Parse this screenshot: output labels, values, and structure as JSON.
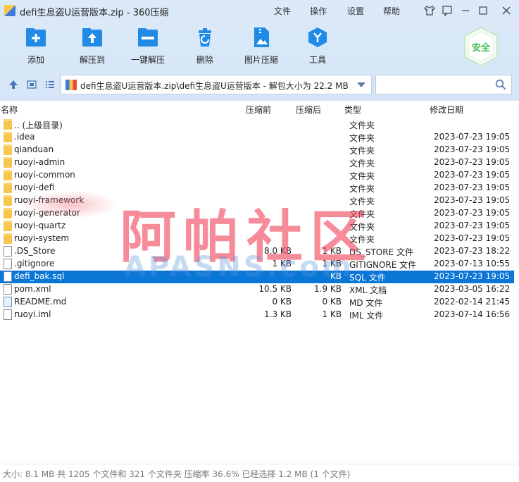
{
  "window": {
    "title": "defi生息盗U运营版本.zip - 360压缩",
    "menus": [
      "文件",
      "操作",
      "设置",
      "帮助"
    ]
  },
  "toolbar": [
    {
      "label": "添加",
      "icon": "add-icon"
    },
    {
      "label": "解压到",
      "icon": "extract-to-icon"
    },
    {
      "label": "一键解压",
      "icon": "one-click-extract-icon"
    },
    {
      "label": "删除",
      "icon": "delete-icon"
    },
    {
      "label": "图片压缩",
      "icon": "image-compress-icon"
    },
    {
      "label": "工具",
      "icon": "tools-icon"
    }
  ],
  "safe_badge": "安全",
  "address": {
    "path": "defi生息盗U运营版本.zip\\defi生息盗U运营版本 - 解包大小为 22.2 MB"
  },
  "columns": {
    "name": "名称",
    "before": "压缩前",
    "after": "压缩后",
    "type": "类型",
    "date": "修改日期"
  },
  "files": [
    {
      "name": ".. (上级目录)",
      "before": "",
      "after": "",
      "type": "文件夹",
      "date": "",
      "kind": "folder"
    },
    {
      "name": ".idea",
      "before": "",
      "after": "",
      "type": "文件夹",
      "date": "2023-07-23 19:05",
      "kind": "folder"
    },
    {
      "name": "qianduan",
      "before": "",
      "after": "",
      "type": "文件夹",
      "date": "2023-07-23 19:05",
      "kind": "folder"
    },
    {
      "name": "ruoyi-admin",
      "before": "",
      "after": "",
      "type": "文件夹",
      "date": "2023-07-23 19:05",
      "kind": "folder"
    },
    {
      "name": "ruoyi-common",
      "before": "",
      "after": "",
      "type": "文件夹",
      "date": "2023-07-23 19:05",
      "kind": "folder"
    },
    {
      "name": "ruoyi-defi",
      "before": "",
      "after": "",
      "type": "文件夹",
      "date": "2023-07-23 19:05",
      "kind": "folder"
    },
    {
      "name": "ruoyi-framework",
      "before": "",
      "after": "",
      "type": "文件夹",
      "date": "2023-07-23 19:05",
      "kind": "folder"
    },
    {
      "name": "ruoyi-generator",
      "before": "",
      "after": "",
      "type": "文件夹",
      "date": "2023-07-23 19:05",
      "kind": "folder"
    },
    {
      "name": "ruoyi-quartz",
      "before": "",
      "after": "",
      "type": "文件夹",
      "date": "2023-07-23 19:05",
      "kind": "folder"
    },
    {
      "name": "ruoyi-system",
      "before": "",
      "after": "",
      "type": "文件夹",
      "date": "2023-07-23 19:05",
      "kind": "folder"
    },
    {
      "name": ".DS_Store",
      "before": "8.0 KB",
      "after": "1 KB",
      "type": "DS_STORE 文件",
      "date": "2023-07-23 18:22",
      "kind": "doc"
    },
    {
      "name": ".gitignore",
      "before": "1 KB",
      "after": "1 KB",
      "type": "GITIGNORE 文件",
      "date": "2023-07-13 10:55",
      "kind": "doc"
    },
    {
      "name": "defi_bak.sql",
      "before": "",
      "after": "KB",
      "type": "SQL 文件",
      "date": "2023-07-23 19:05",
      "kind": "sql",
      "selected": true
    },
    {
      "name": "pom.xml",
      "before": "10.5 KB",
      "after": "1.9 KB",
      "type": "XML 文档",
      "date": "2023-03-05 16:22",
      "kind": "doc"
    },
    {
      "name": "README.md",
      "before": "0 KB",
      "after": "0 KB",
      "type": "MD 文件",
      "date": "2022-02-14 21:45",
      "kind": "md"
    },
    {
      "name": "ruoyi.iml",
      "before": "1.3 KB",
      "after": "1 KB",
      "type": "IML 文件",
      "date": "2023-07-14 16:56",
      "kind": "doc"
    }
  ],
  "watermark": {
    "cn": "阿帕社区",
    "en": "APASNS.com"
  },
  "status": "大小: 8.1 MB 共 1205 个文件和 321 个文件夹 压缩率 36.6% 已经选择 1.2 MB (1 个文件)"
}
